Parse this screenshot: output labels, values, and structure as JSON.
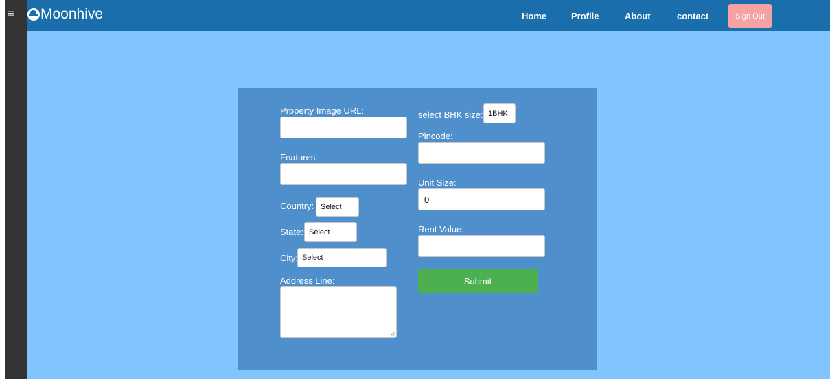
{
  "nav": {
    "brand": "Moonhive",
    "links": [
      "Home",
      "Profile",
      "About",
      "contact"
    ],
    "signout_label": "Sign Out"
  },
  "form": {
    "image_url": {
      "label": "Property Image URL:",
      "value": ""
    },
    "features": {
      "label": "Features:",
      "value": ""
    },
    "country": {
      "label": "Country:",
      "selected": "Select"
    },
    "state": {
      "label": "State:",
      "selected": "Select"
    },
    "city": {
      "label": "City:",
      "selected": "Select"
    },
    "address": {
      "label": "Address Line:",
      "value": ""
    },
    "bhk": {
      "label": "select BHK size:",
      "selected": "1BHK"
    },
    "pincode": {
      "label": "Pincode:",
      "value": ""
    },
    "unit_size": {
      "label": "Unit Size:",
      "value": "0"
    },
    "rent": {
      "label": "Rent Value:",
      "value": ""
    },
    "submit_label": "Submit"
  },
  "colors": {
    "navbar": "#1a6eab",
    "page_background": "#82c4fd",
    "form_panel": "#4f90cc",
    "submit": "#4caf50",
    "signout": "#f4a2a2",
    "side_strip": "#333333"
  },
  "icons": {
    "menu": "hamburger-icon",
    "brand": "moonhive-logo-icon"
  }
}
